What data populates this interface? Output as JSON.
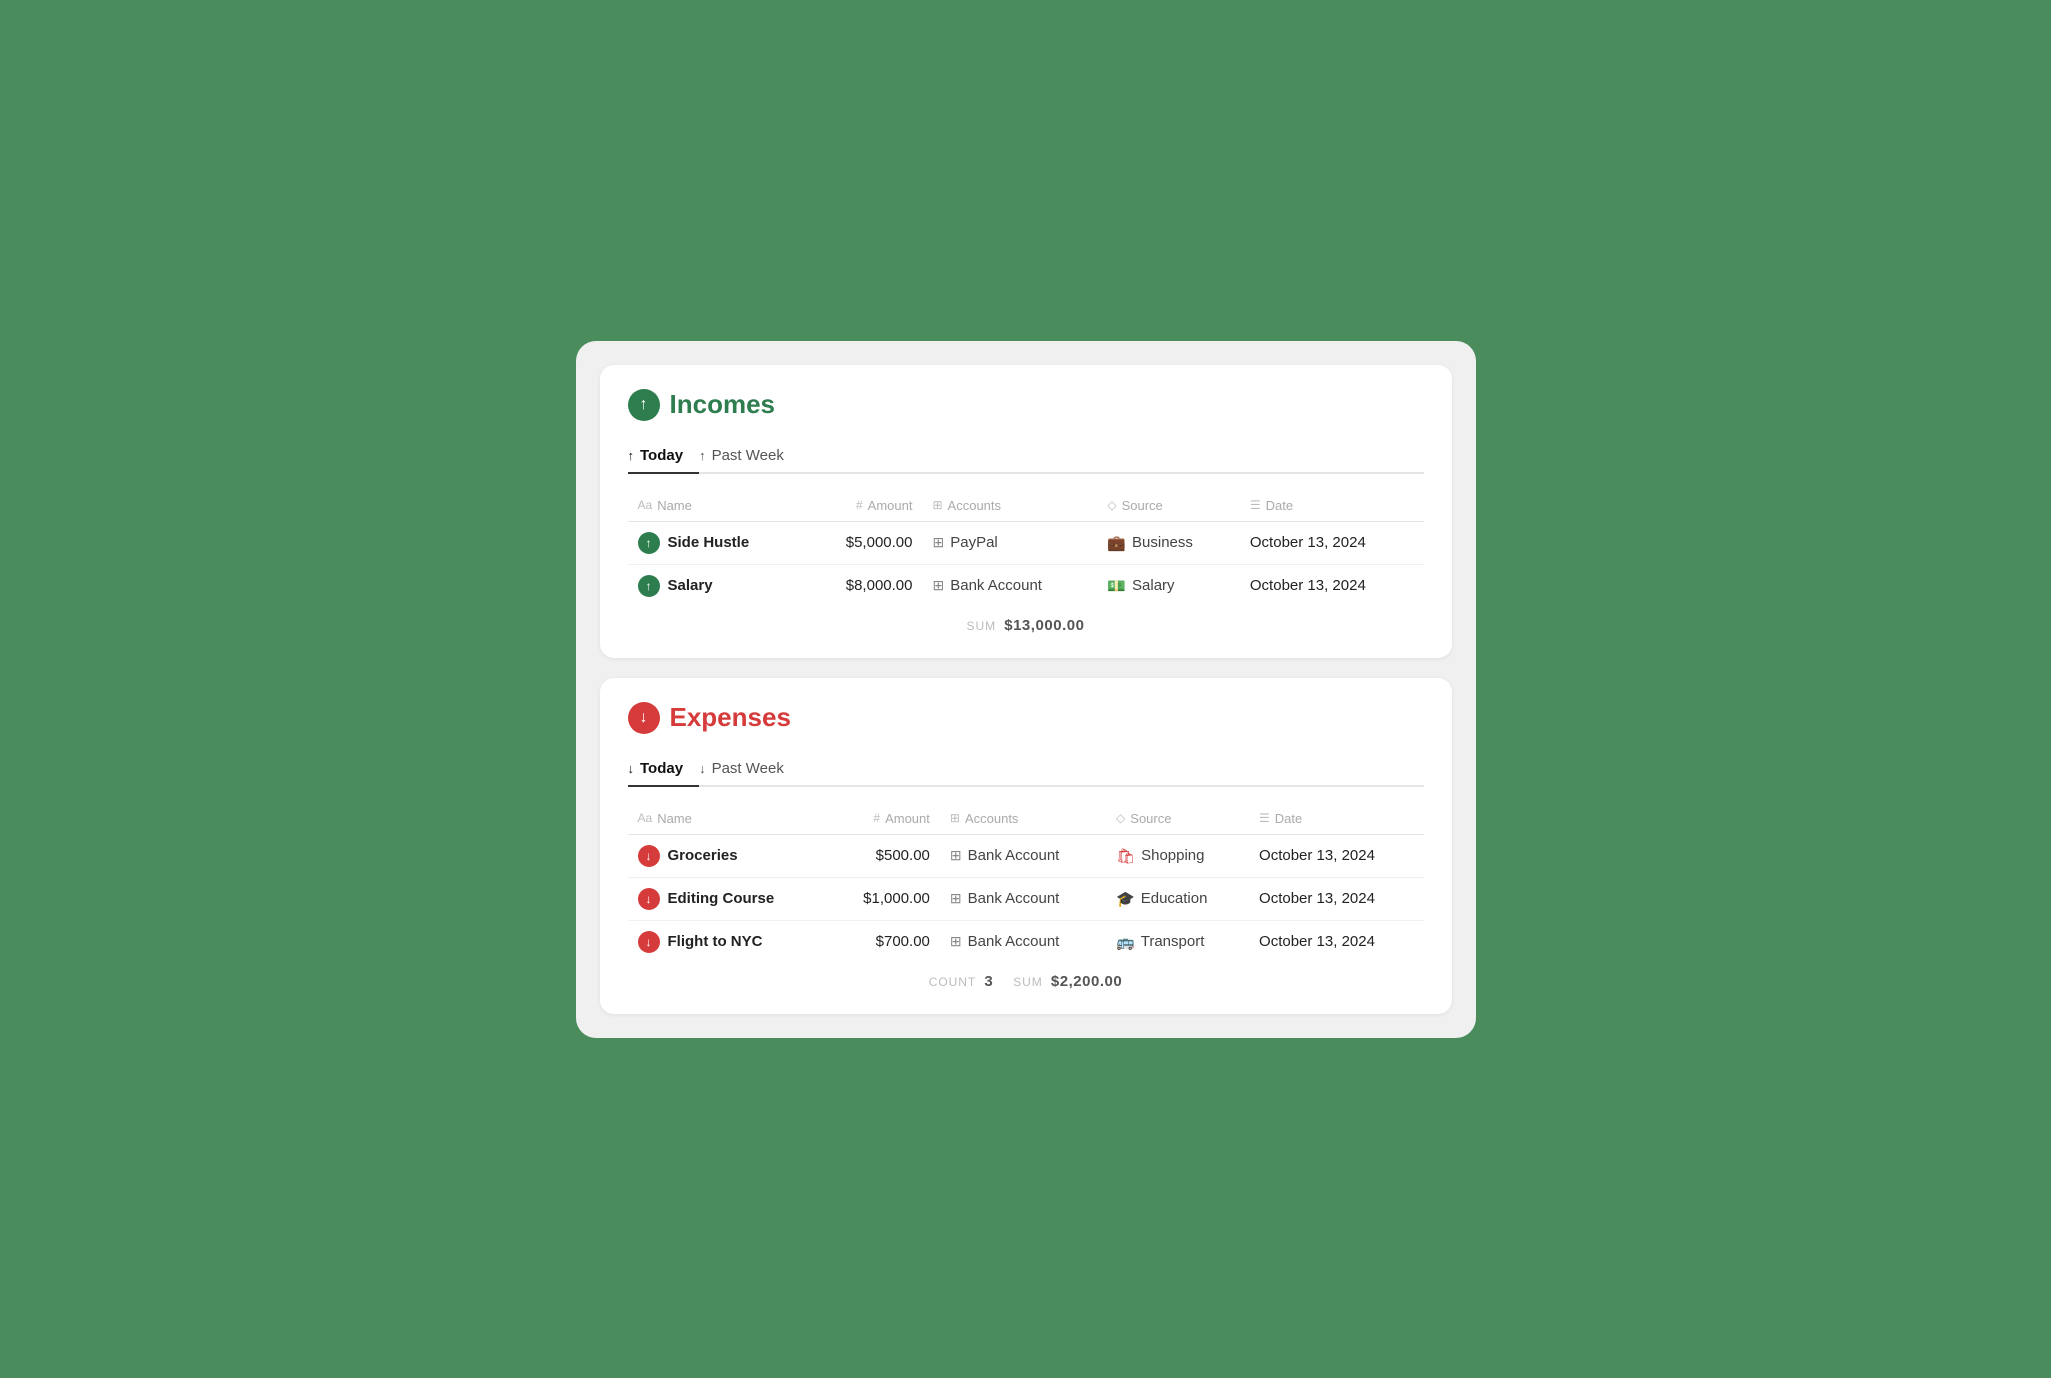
{
  "incomes": {
    "title": "Incomes",
    "icon_arrow": "↑",
    "tabs": [
      {
        "label": "Today",
        "active": true
      },
      {
        "label": "Past Week",
        "active": false
      }
    ],
    "columns": [
      {
        "icon": "Aa",
        "label": "Name"
      },
      {
        "icon": "#",
        "label": "Amount"
      },
      {
        "icon": "⊞",
        "label": "Accounts"
      },
      {
        "icon": "◇",
        "label": "Source"
      },
      {
        "icon": "☰",
        "label": "Date"
      }
    ],
    "rows": [
      {
        "name": "Side Hustle",
        "amount": "$5,000.00",
        "account": "PayPal",
        "source": "Business",
        "source_icon": "💼",
        "date": "October 13, 2024"
      },
      {
        "name": "Salary",
        "amount": "$8,000.00",
        "account": "Bank Account",
        "source": "Salary",
        "source_icon": "💵",
        "date": "October 13, 2024"
      }
    ],
    "sum_label": "SUM",
    "sum_value": "$13,000.00"
  },
  "expenses": {
    "title": "Expenses",
    "icon_arrow": "↓",
    "tabs": [
      {
        "label": "Today",
        "active": true
      },
      {
        "label": "Past Week",
        "active": false
      }
    ],
    "columns": [
      {
        "icon": "Aa",
        "label": "Name"
      },
      {
        "icon": "#",
        "label": "Amount"
      },
      {
        "icon": "⊞",
        "label": "Accounts"
      },
      {
        "icon": "◇",
        "label": "Source"
      },
      {
        "icon": "☰",
        "label": "Date"
      }
    ],
    "rows": [
      {
        "name": "Groceries",
        "amount": "$500.00",
        "account": "Bank Account",
        "source": "Shopping",
        "source_icon": "🛍",
        "date": "October 13, 2024"
      },
      {
        "name": "Editing Course",
        "amount": "$1,000.00",
        "account": "Bank Account",
        "source": "Education",
        "source_icon": "🎓",
        "date": "October 13, 2024"
      },
      {
        "name": "Flight to NYC",
        "amount": "$700.00",
        "account": "Bank Account",
        "source": "Transport",
        "source_icon": "🚌",
        "date": "October 13, 2024"
      }
    ],
    "count_label": "COUNT",
    "count_value": "3",
    "sum_label": "SUM",
    "sum_value": "$2,200.00"
  }
}
